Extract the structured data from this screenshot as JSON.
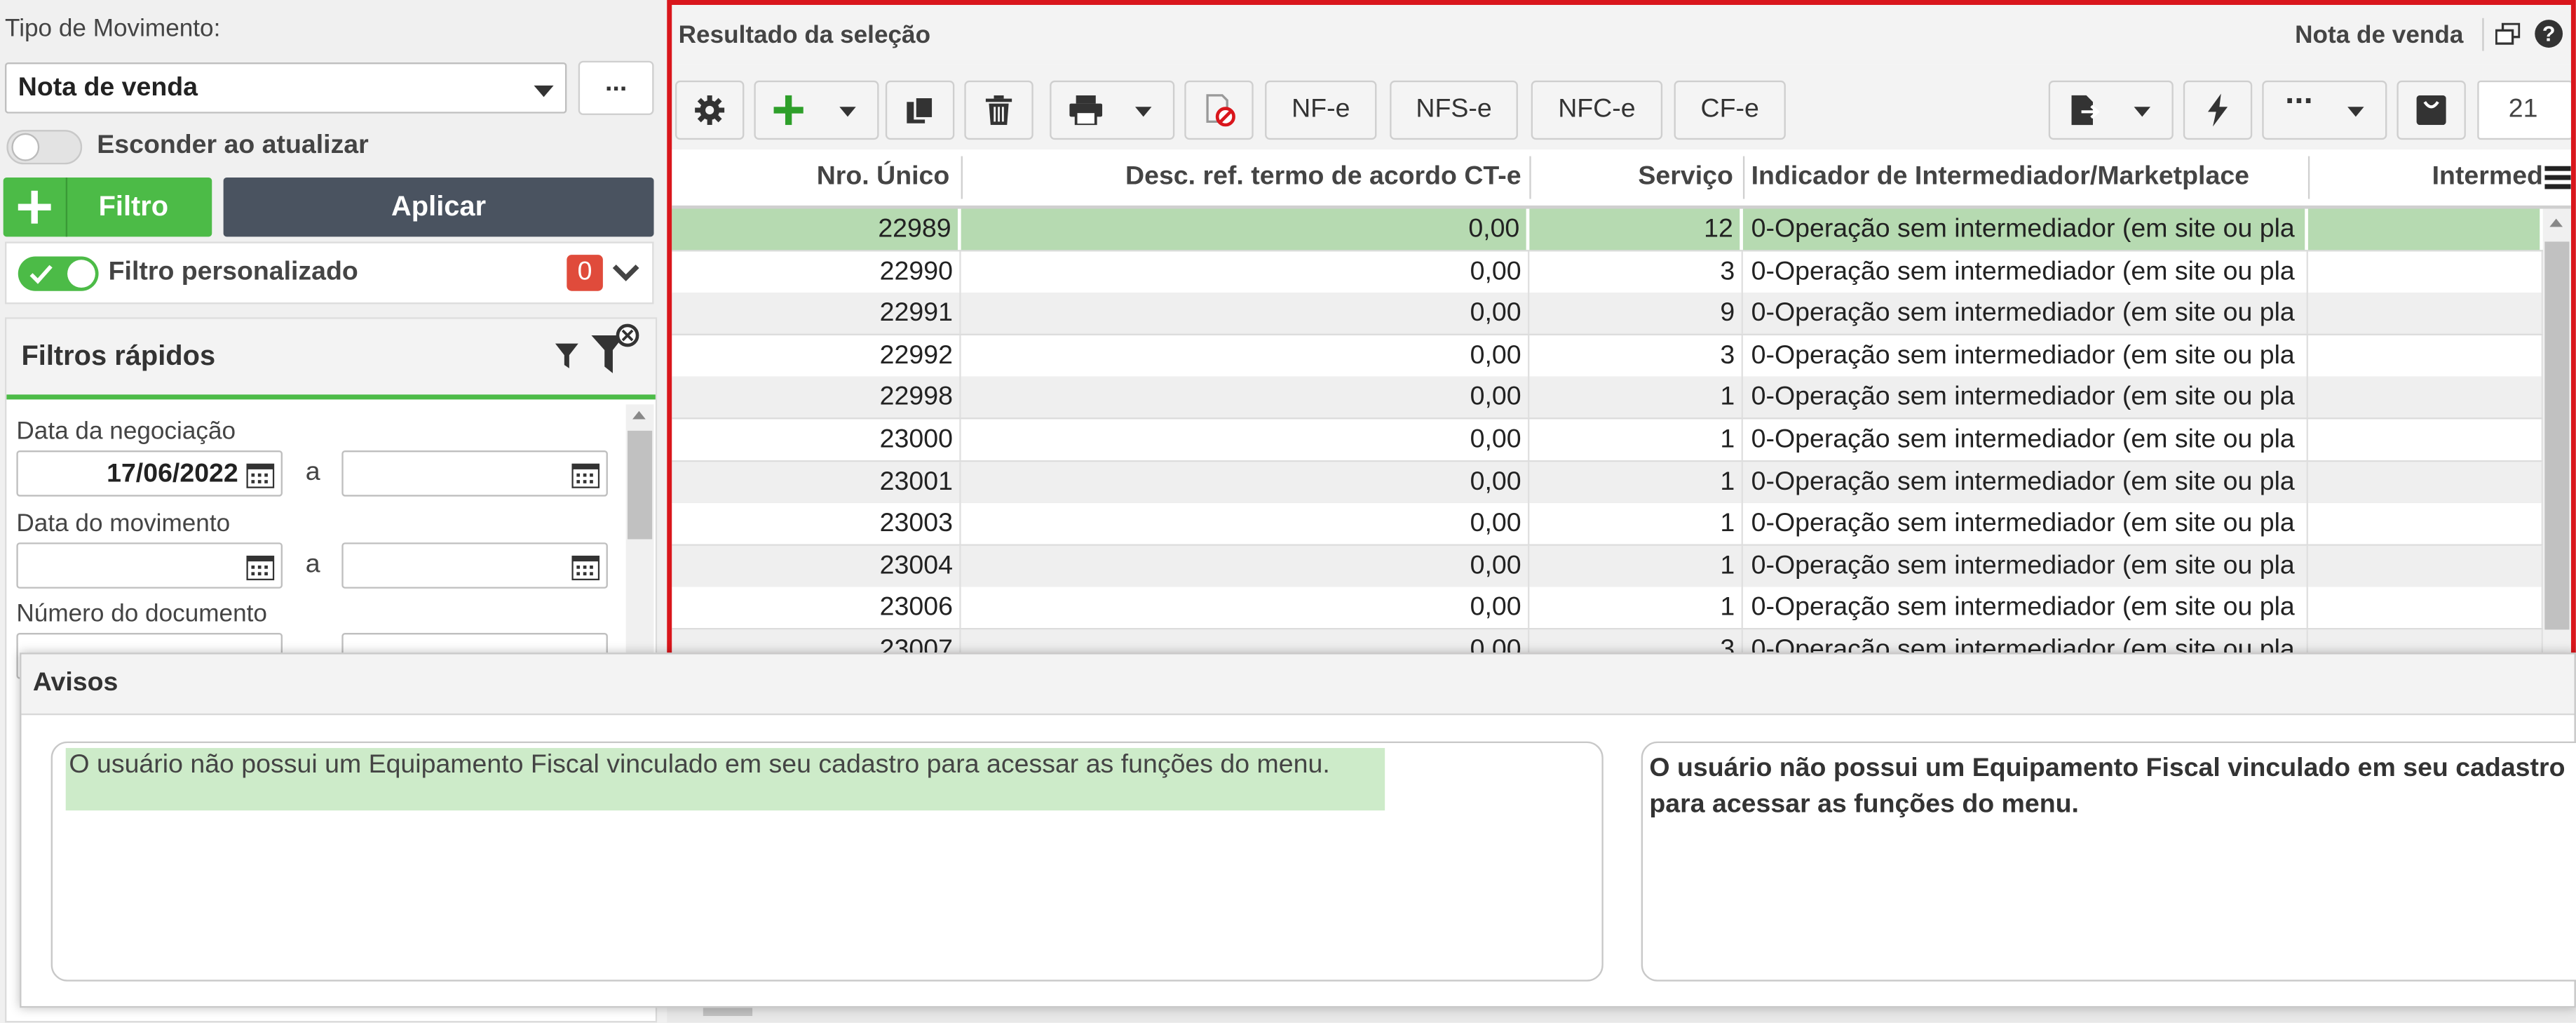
{
  "left": {
    "movement_type_label": "Tipo de Movimento:",
    "movement_type_value": "Nota de venda",
    "more_button": "...",
    "hide_on_update_label": "Esconder ao atualizar",
    "filter_button": "Filtro",
    "apply_button": "Aplicar",
    "custom_filter_label": "Filtro personalizado",
    "custom_filter_count": "0",
    "quick_filters_title": "Filtros rápidos",
    "negotiation_date_label": "Data da negociação",
    "negotiation_date_from": "17/06/2022",
    "range_sep": "a",
    "movement_date_label": "Data do movimento",
    "document_number_label": "Número do documento"
  },
  "result": {
    "title": "Resultado da seleção",
    "current_type": "Nota de venda",
    "toolbar": {
      "nfe": "NF-e",
      "nfse": "NFS-e",
      "nfce": "NFC-e",
      "cfe": "CF-e",
      "page_size": "21"
    },
    "columns": [
      "Nro. Único",
      "Desc. ref. termo de acordo CT-e",
      "Serviço",
      "Indicador de Intermediador/Marketplace",
      "Intermed"
    ],
    "rows": [
      {
        "id": "22989",
        "desc": "0,00",
        "svc": "12",
        "ind": "0-Operação sem intermediador (em site ou pla"
      },
      {
        "id": "22990",
        "desc": "0,00",
        "svc": "3",
        "ind": "0-Operação sem intermediador (em site ou pla"
      },
      {
        "id": "22991",
        "desc": "0,00",
        "svc": "9",
        "ind": "0-Operação sem intermediador (em site ou pla"
      },
      {
        "id": "22992",
        "desc": "0,00",
        "svc": "3",
        "ind": "0-Operação sem intermediador (em site ou pla"
      },
      {
        "id": "22998",
        "desc": "0,00",
        "svc": "1",
        "ind": "0-Operação sem intermediador (em site ou pla"
      },
      {
        "id": "23000",
        "desc": "0,00",
        "svc": "1",
        "ind": "0-Operação sem intermediador (em site ou pla"
      },
      {
        "id": "23001",
        "desc": "0,00",
        "svc": "1",
        "ind": "0-Operação sem intermediador (em site ou pla"
      },
      {
        "id": "23003",
        "desc": "0,00",
        "svc": "1",
        "ind": "0-Operação sem intermediador (em site ou pla"
      },
      {
        "id": "23004",
        "desc": "0,00",
        "svc": "1",
        "ind": "0-Operação sem intermediador (em site ou pla"
      },
      {
        "id": "23006",
        "desc": "0,00",
        "svc": "1",
        "ind": "0-Operação sem intermediador (em site ou pla"
      },
      {
        "id": "23007",
        "desc": "0,00",
        "svc": "3",
        "ind": "0-Operação sem intermediador (em site ou pla"
      }
    ]
  },
  "notices": {
    "title": "Avisos",
    "list_message": "O usuário não possui um Equipamento Fiscal vinculado em seu cadastro para acessar as funções do menu.",
    "detail_message": "O usuário não possui um Equipamento Fiscal vinculado em seu cadastro para acessar as funções do menu."
  },
  "colors": {
    "accent_green": "#4cbb47",
    "selection_red": "#d9161c",
    "selected_row": "#b6dab1",
    "dark_button": "#4a5360",
    "badge_red": "#e04b3b"
  },
  "icons": [
    "gear-icon",
    "plus-icon",
    "caret-down-icon",
    "duplicate-icon",
    "trash-icon",
    "printer-icon",
    "no-print-icon",
    "export-icon",
    "lightning-icon",
    "more-icon",
    "bag-icon",
    "restore-window-icon",
    "help-icon",
    "columns-menu-icon",
    "funnel-icon",
    "funnel-clear-icon",
    "calendar-icon",
    "chevron-down-icon"
  ]
}
